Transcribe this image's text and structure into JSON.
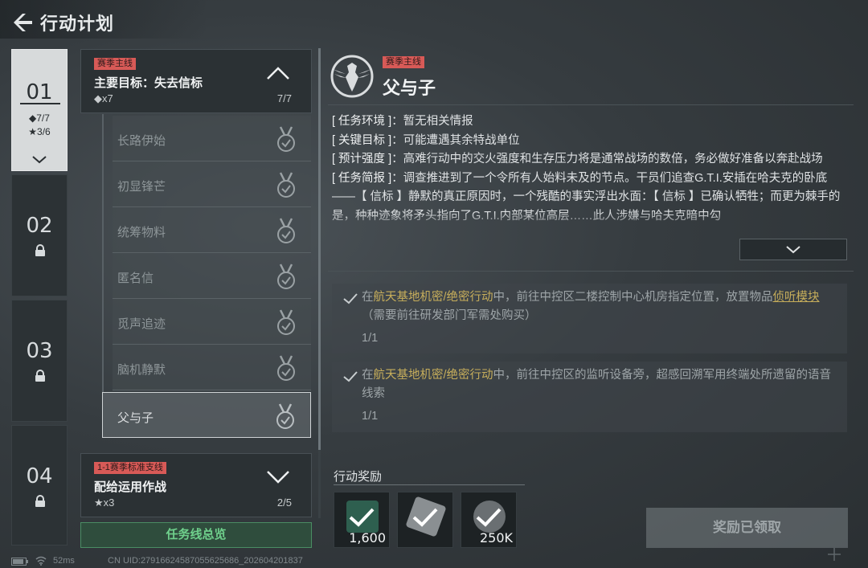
{
  "header": {
    "title": "行动计划"
  },
  "chapters": [
    {
      "num": "01",
      "diamond": "◆7/7",
      "star": "★3/6",
      "active": true
    },
    {
      "num": "02",
      "locked": true
    },
    {
      "num": "03",
      "locked": true
    },
    {
      "num": "04",
      "locked": true
    }
  ],
  "main_mission": {
    "tag": "赛季主线",
    "title": "主要目标：失去信标",
    "reward": "◆x7",
    "progress": "7/7"
  },
  "sub_missions": [
    "长路伊始",
    "初显锋芒",
    "统筹物料",
    "匿名信",
    "觅声追迹",
    "脑机静默",
    "父与子"
  ],
  "side_mission": {
    "tag": "1-1赛季标准支线",
    "title": "配给运用作战",
    "reward": "★x3",
    "progress": "2/5"
  },
  "overview_button": "任务线总览",
  "detail": {
    "tag": "赛季主线",
    "title": "父与子",
    "env_key": "[ 任务环境 ]",
    "env_val": "：暂无相关情报",
    "target_key": "[ 关键目标 ]",
    "target_val": "：可能遭遇其余特战单位",
    "strength_key": "[ 预计强度 ]",
    "strength_val": "：高难行动中的交火强度和生存压力将是通常战场的数倍，务必做好准备以奔赴战场",
    "brief_key": "[ 任务简报 ]",
    "brief_val": "：调查推进到了一个令所有人始料未及的节点。干员们追查G.T.I.安插在哈夫克的卧底——【 信标 】静默的真正原因时，一个残酷的事实浮出水面：【 信标 】已确认牺牲；而更为棘手的是，种种迹象将矛头指向了G.T.I.内部某位高层……此人涉嫌与哈夫克暗中勾"
  },
  "tasks": [
    {
      "pre": "在",
      "place": "航天基地机密/绝密行动",
      "mid": "中，前往中控区二楼控制中心机房指定位置，放置物品",
      "item": "侦听模块",
      "post": "（需要前往研发部门军需处购买）",
      "progress": "1/1"
    },
    {
      "pre": "在",
      "place": "航天基地机密/绝密行动",
      "mid": "中，前往中控区的监听设备旁，超感回溯军用终端处所遗留的语音线索",
      "progress": "1/1"
    }
  ],
  "rewards": {
    "title": "行动奖励",
    "items": [
      {
        "qty": "1,600",
        "icon": "exp-card-icon"
      },
      {
        "qty": "",
        "icon": "silver-item-icon"
      },
      {
        "qty": "250K",
        "icon": "coin-icon"
      }
    ],
    "claim_label": "奖励已领取"
  },
  "footer": {
    "ping": "52ms",
    "uid": "CN UID:27916624587055625686_202604201837"
  }
}
